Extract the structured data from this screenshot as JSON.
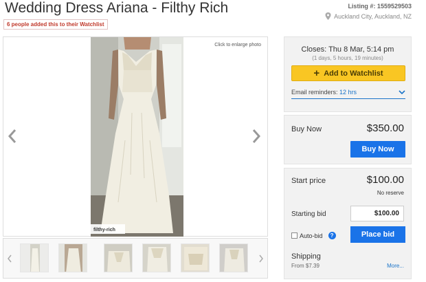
{
  "listing": {
    "title": "Wedding Dress Ariana - Filthy Rich",
    "watchlist_badge": "6 people added this to their Watchlist",
    "listing_number": "Listing #: 1559529503",
    "location": "Auckland City, Auckland, NZ"
  },
  "gallery": {
    "enlarge_hint": "Click to enlarge photo",
    "photo_watermark": "filthy-rich",
    "thumbnail_count": 6
  },
  "auction": {
    "closes": "Closes: Thu 8 Mar, 5:14 pm",
    "time_remaining": "(1 days, 5 hours, 19 minutes)",
    "watchlist_button": "Add to Watchlist",
    "email_reminders_label": "Email reminders:",
    "email_reminders_value": "12 hrs"
  },
  "buy_now": {
    "label": "Buy Now",
    "price": "$350.00",
    "button": "Buy Now"
  },
  "bidding": {
    "start_price_label": "Start price",
    "start_price": "$100.00",
    "reserve_note": "No reserve",
    "starting_bid_label": "Starting bid",
    "starting_bid_value": "$100.00",
    "autobid_label": "Auto-bid",
    "place_bid_button": "Place bid"
  },
  "shipping": {
    "title": "Shipping",
    "from": "From $7.39",
    "more_link": "More..."
  },
  "colors": {
    "accent_blue": "#1a73e8",
    "watchlist_yellow": "#f9c623",
    "badge_red": "#c0392b"
  }
}
